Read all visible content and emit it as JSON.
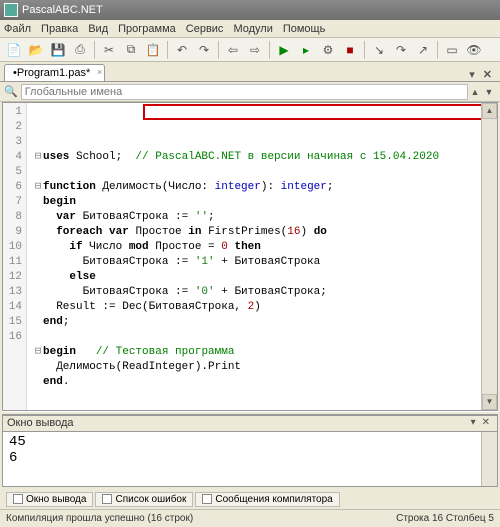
{
  "window": {
    "title": "PascalABC.NET"
  },
  "menu": [
    "Файл",
    "Правка",
    "Вид",
    "Программа",
    "Сервис",
    "Модули",
    "Помощь"
  ],
  "tab": {
    "label": "•Program1.pas*"
  },
  "find": {
    "placeholder": "Глобальные имена"
  },
  "code": {
    "lines": [
      {
        "n": "1",
        "fold": "⊟",
        "seg": [
          [
            "kw",
            "uses"
          ],
          [
            "id",
            " School;  "
          ],
          [
            "cm",
            "// PascalABC.NET в версии начиная с 15.04.2020"
          ]
        ]
      },
      {
        "n": "2",
        "fold": "",
        "seg": []
      },
      {
        "n": "3",
        "fold": "⊟",
        "seg": [
          [
            "kw",
            "function"
          ],
          [
            "id",
            " Делимость(Число: "
          ],
          [
            "ty",
            "integer"
          ],
          [
            "id",
            "): "
          ],
          [
            "ty",
            "integer"
          ],
          [
            "id",
            ";"
          ]
        ]
      },
      {
        "n": "4",
        "fold": "",
        "seg": [
          [
            "kw",
            "begin"
          ]
        ]
      },
      {
        "n": "5",
        "fold": "",
        "seg": [
          [
            "id",
            "  "
          ],
          [
            "kw",
            "var"
          ],
          [
            "id",
            " БитоваяСтрока := "
          ],
          [
            "st",
            "''"
          ],
          [
            "id",
            ";"
          ]
        ]
      },
      {
        "n": "6",
        "fold": "",
        "seg": [
          [
            "id",
            "  "
          ],
          [
            "kw",
            "foreach"
          ],
          [
            "id",
            " "
          ],
          [
            "kw",
            "var"
          ],
          [
            "id",
            " Простое "
          ],
          [
            "kw",
            "in"
          ],
          [
            "id",
            " FirstPrimes("
          ],
          [
            "nm",
            "16"
          ],
          [
            "id",
            ") "
          ],
          [
            "kw",
            "do"
          ]
        ]
      },
      {
        "n": "7",
        "fold": "",
        "seg": [
          [
            "id",
            "    "
          ],
          [
            "kw",
            "if"
          ],
          [
            "id",
            " Число "
          ],
          [
            "kw",
            "mod"
          ],
          [
            "id",
            " Простое = "
          ],
          [
            "nm",
            "0"
          ],
          [
            "id",
            " "
          ],
          [
            "kw",
            "then"
          ]
        ]
      },
      {
        "n": "8",
        "fold": "",
        "seg": [
          [
            "id",
            "      БитоваяСтрока := "
          ],
          [
            "st",
            "'1'"
          ],
          [
            "id",
            " + БитоваяСтрока"
          ]
        ]
      },
      {
        "n": "9",
        "fold": "",
        "seg": [
          [
            "id",
            "    "
          ],
          [
            "kw",
            "else"
          ]
        ]
      },
      {
        "n": "10",
        "fold": "",
        "seg": [
          [
            "id",
            "      БитоваяСтрока := "
          ],
          [
            "st",
            "'0'"
          ],
          [
            "id",
            " + БитоваяСтрока;"
          ]
        ]
      },
      {
        "n": "11",
        "fold": "",
        "seg": [
          [
            "id",
            "  Result := Dec(БитоваяСтрока, "
          ],
          [
            "nm",
            "2"
          ],
          [
            "id",
            ")"
          ]
        ]
      },
      {
        "n": "12",
        "fold": "",
        "seg": [
          [
            "kw",
            "end"
          ],
          [
            "id",
            ";"
          ]
        ]
      },
      {
        "n": "13",
        "fold": "",
        "seg": []
      },
      {
        "n": "14",
        "fold": "⊟",
        "seg": [
          [
            "kw",
            "begin"
          ],
          [
            "id",
            "   "
          ],
          [
            "cm",
            "// Тестовая программа"
          ]
        ]
      },
      {
        "n": "15",
        "fold": "",
        "seg": [
          [
            "id",
            "  Делимость(ReadInteger).Print"
          ]
        ]
      },
      {
        "n": "16",
        "fold": "",
        "seg": [
          [
            "kw",
            "end"
          ],
          [
            "id",
            "."
          ]
        ]
      }
    ]
  },
  "out_panel": {
    "title": "Окно вывода",
    "text": "45\n6"
  },
  "bottom_tabs": [
    "Окно вывода",
    "Список ошибок",
    "Сообщения компилятора"
  ],
  "status": {
    "left": "Компиляция прошла успешно (16 строк)",
    "right": "Строка  16  Столбец  5"
  }
}
